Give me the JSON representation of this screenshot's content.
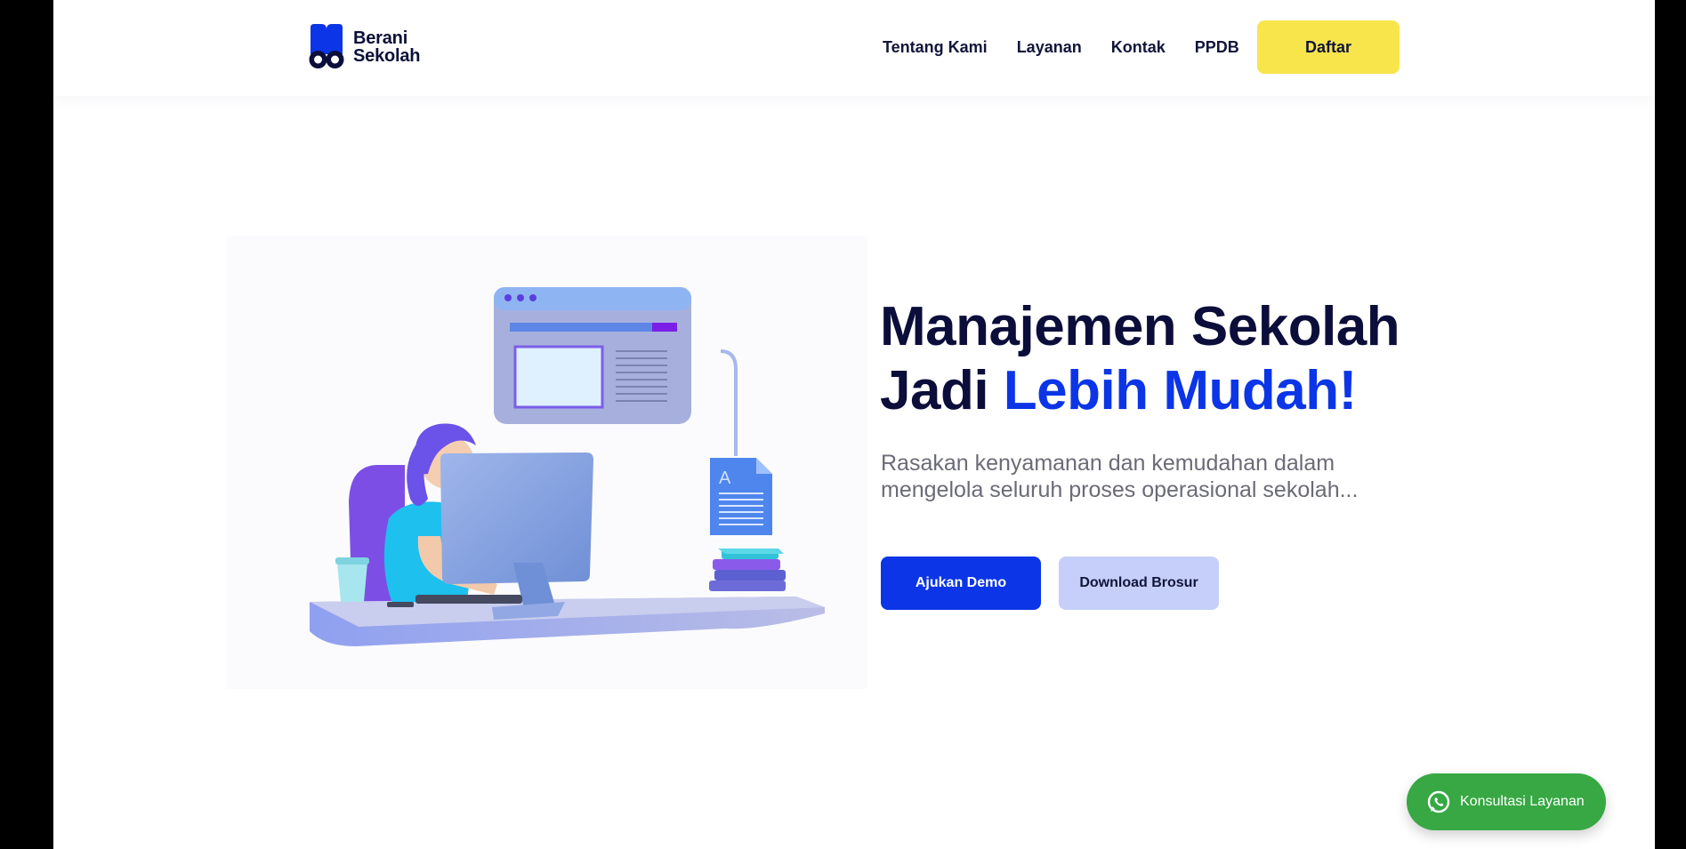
{
  "brand": {
    "name_line1": "Berani",
    "name_line2": "Sekolah",
    "logo_icon": "berani-sekolah-logo",
    "color": "#0b35e6"
  },
  "nav": {
    "links": [
      "Tentang Kami",
      "Layanan",
      "Kontak",
      "PPDB"
    ],
    "cta_label": "Daftar",
    "cta_color": "#f8e54c"
  },
  "hero": {
    "title_line1": "Manajemen Sekolah",
    "title_line2_prefix": "Jadi ",
    "title_line2_accent": "Lebih Mudah!",
    "accent_color": "#0b35e6",
    "subtitle_line1": "Rasakan kenyamanan dan kemudahan dalam",
    "subtitle_line2": "mengelola seluruh proses operasional sekolah...",
    "primary_button": "Ajukan Demo",
    "secondary_button": "Download Brosur",
    "illustration": "person-working-at-computer-illustration"
  },
  "floating": {
    "label": "Konsultasi Layanan",
    "icon": "whatsapp-icon",
    "color": "#37a843"
  }
}
